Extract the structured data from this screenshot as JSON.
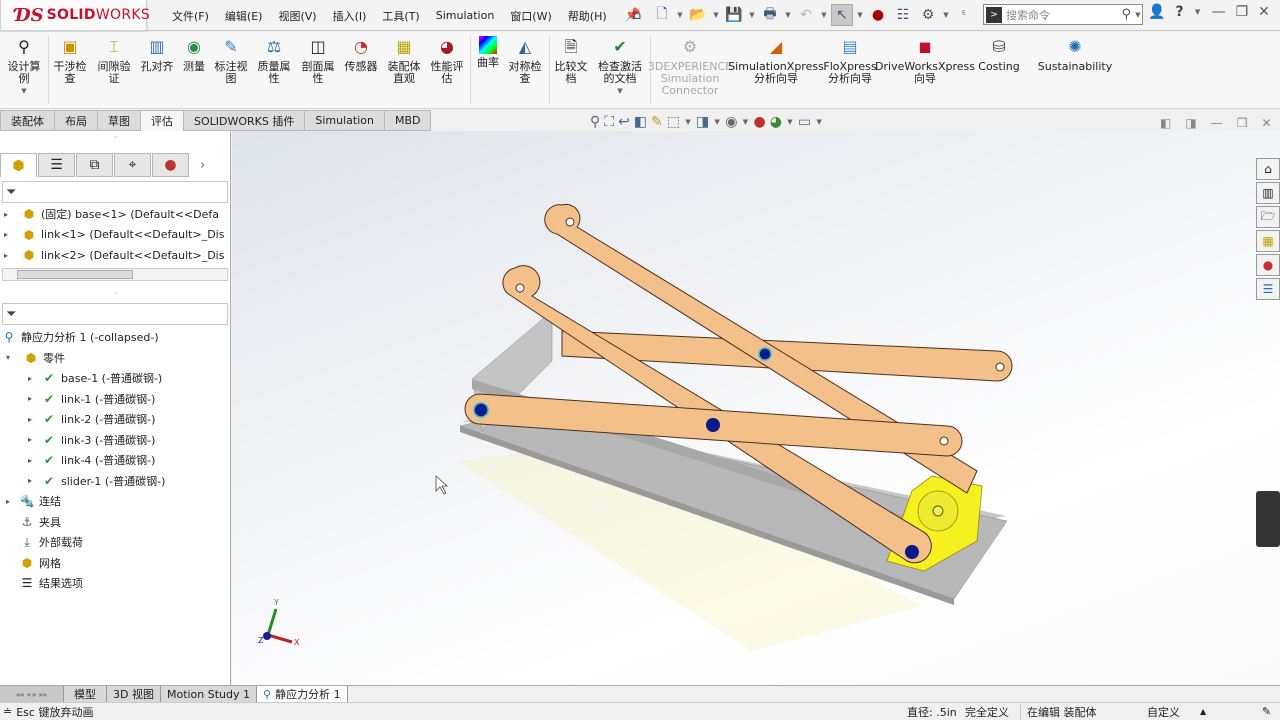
{
  "app": {
    "brand_prefix": "SOLID",
    "brand_suffix": "WORKS"
  },
  "menu": [
    "文件(F)",
    "编辑(E)",
    "视图(V)",
    "插入(I)",
    "工具(T)",
    "Simulation",
    "窗口(W)",
    "帮助(H)"
  ],
  "search": {
    "placeholder": "搜索命令"
  },
  "commands": [
    {
      "label": "设计算例",
      "icon": "design-study-icon"
    },
    {
      "label": "干涉检查",
      "icon": "interference-icon"
    },
    {
      "label": "间隙验证",
      "icon": "clearance-icon"
    },
    {
      "label": "孔对齐",
      "icon": "hole-align-icon"
    },
    {
      "label": "测量",
      "icon": "measure-icon"
    },
    {
      "label": "标注视图",
      "icon": "annotation-view-icon"
    },
    {
      "label": "质量属性",
      "icon": "mass-properties-icon"
    },
    {
      "label": "剖面属性",
      "icon": "section-properties-icon"
    },
    {
      "label": "传感器",
      "icon": "sensor-icon"
    },
    {
      "label": "装配体直观",
      "icon": "assembly-visualization-icon"
    },
    {
      "label": "性能评估",
      "icon": "performance-icon"
    },
    {
      "label": "曲率",
      "icon": "curvature-icon"
    },
    {
      "label": "对称检查",
      "icon": "symmetry-icon"
    },
    {
      "label": "比较文档",
      "icon": "compare-icon"
    },
    {
      "label": "检查激活的文档",
      "icon": "check-doc-icon"
    },
    {
      "label": "3DEXPERIENCE Simulation Connector",
      "icon": "connector-icon",
      "disabled": true
    },
    {
      "label": "SimulationXpress 分析向导",
      "icon": "simxpress-icon"
    },
    {
      "label": "FloXpress 分析向导",
      "icon": "floxpress-icon"
    },
    {
      "label": "DriveWorksXpress 向导",
      "icon": "driveworks-icon"
    },
    {
      "label": "Costing",
      "icon": "costing-icon"
    },
    {
      "label": "Sustainability",
      "icon": "sustainability-icon"
    }
  ],
  "tabs": [
    {
      "label": "装配体"
    },
    {
      "label": "布局"
    },
    {
      "label": "草图"
    },
    {
      "label": "评估",
      "active": true
    },
    {
      "label": "SOLIDWORKS 插件"
    },
    {
      "label": "Simulation"
    },
    {
      "label": "MBD"
    }
  ],
  "feature_tree": [
    {
      "label": "(固定) base<1> (Default<<Defa"
    },
    {
      "label": "link<1> (Default<<Default>_Dis"
    },
    {
      "label": "link<2> (Default<<Default>_Dis"
    }
  ],
  "sim_tree": {
    "study": "静应力分析 1 (-collapsed-)",
    "parts_label": "零件",
    "parts": [
      "base-1 (-普通碳钢-)",
      "link-1 (-普通碳钢-)",
      "link-2 (-普通碳钢-)",
      "link-3 (-普通碳钢-)",
      "link-4 (-普通碳钢-)",
      "slider-1 (-普通碳钢-)"
    ],
    "items": [
      "连结",
      "夹具",
      "外部载荷",
      "网格",
      "结果选项"
    ]
  },
  "bottom_tabs": [
    {
      "label": "模型"
    },
    {
      "label": "3D 视图"
    },
    {
      "label": "Motion Study 1"
    },
    {
      "label": "静应力分析 1",
      "active": true
    }
  ],
  "status": {
    "left": "Esc 键放弃动画",
    "diameter": "直径: .5in",
    "defined": "完全定义",
    "editing": "在编辑 装配体",
    "units": "自定义"
  },
  "axes": {
    "x": "X",
    "y": "Y",
    "z": "Z"
  }
}
